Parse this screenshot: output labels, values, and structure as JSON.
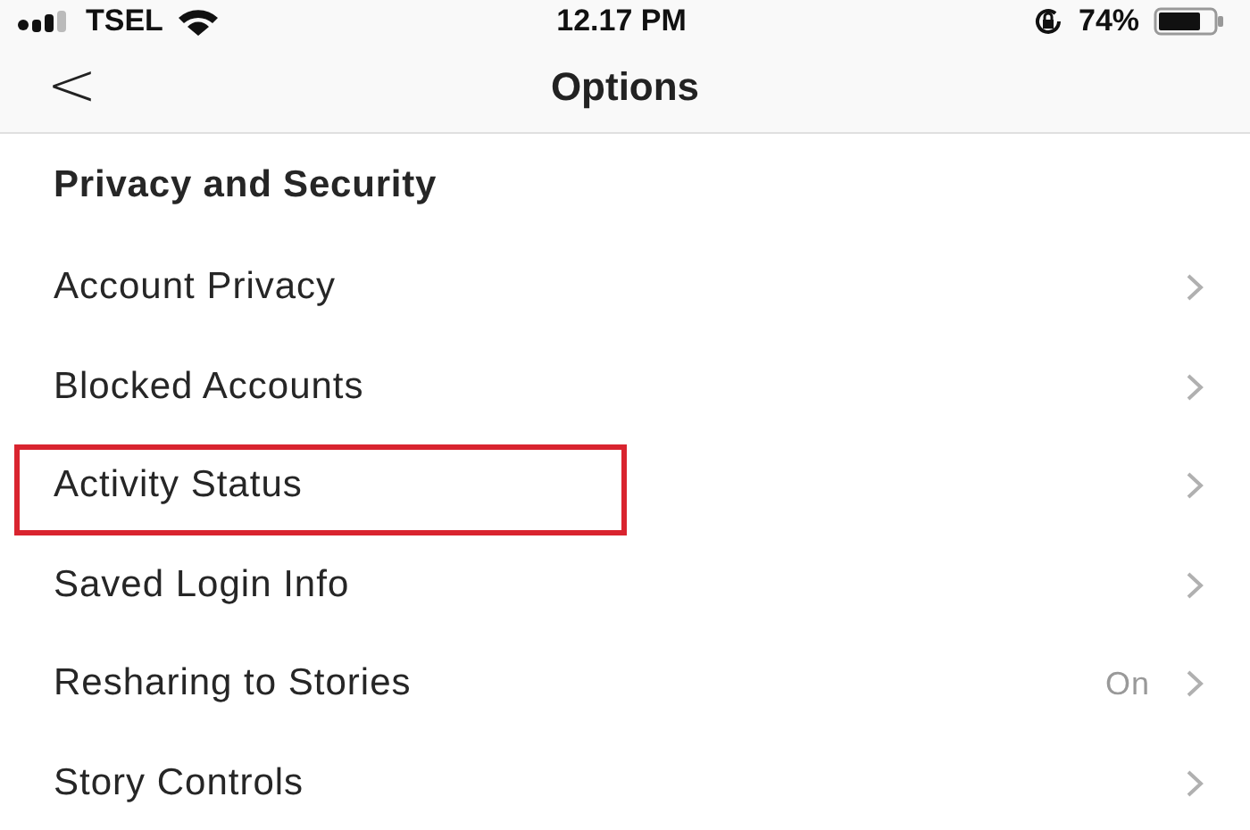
{
  "status_bar": {
    "carrier": "TSEL",
    "time": "12.17 PM",
    "battery": "74%"
  },
  "nav": {
    "back": "<",
    "title": "Options"
  },
  "section": {
    "title": "Privacy and Security"
  },
  "items": [
    {
      "label": "Account Privacy",
      "highlighted": false
    },
    {
      "label": "Blocked Accounts",
      "highlighted": false
    },
    {
      "label": "Activity Status",
      "highlighted": true
    },
    {
      "label": "Saved Login Info",
      "highlighted": false
    },
    {
      "label": "Resharing to Stories",
      "value": "On",
      "highlighted": false
    },
    {
      "label": "Story Controls",
      "highlighted": false
    }
  ]
}
